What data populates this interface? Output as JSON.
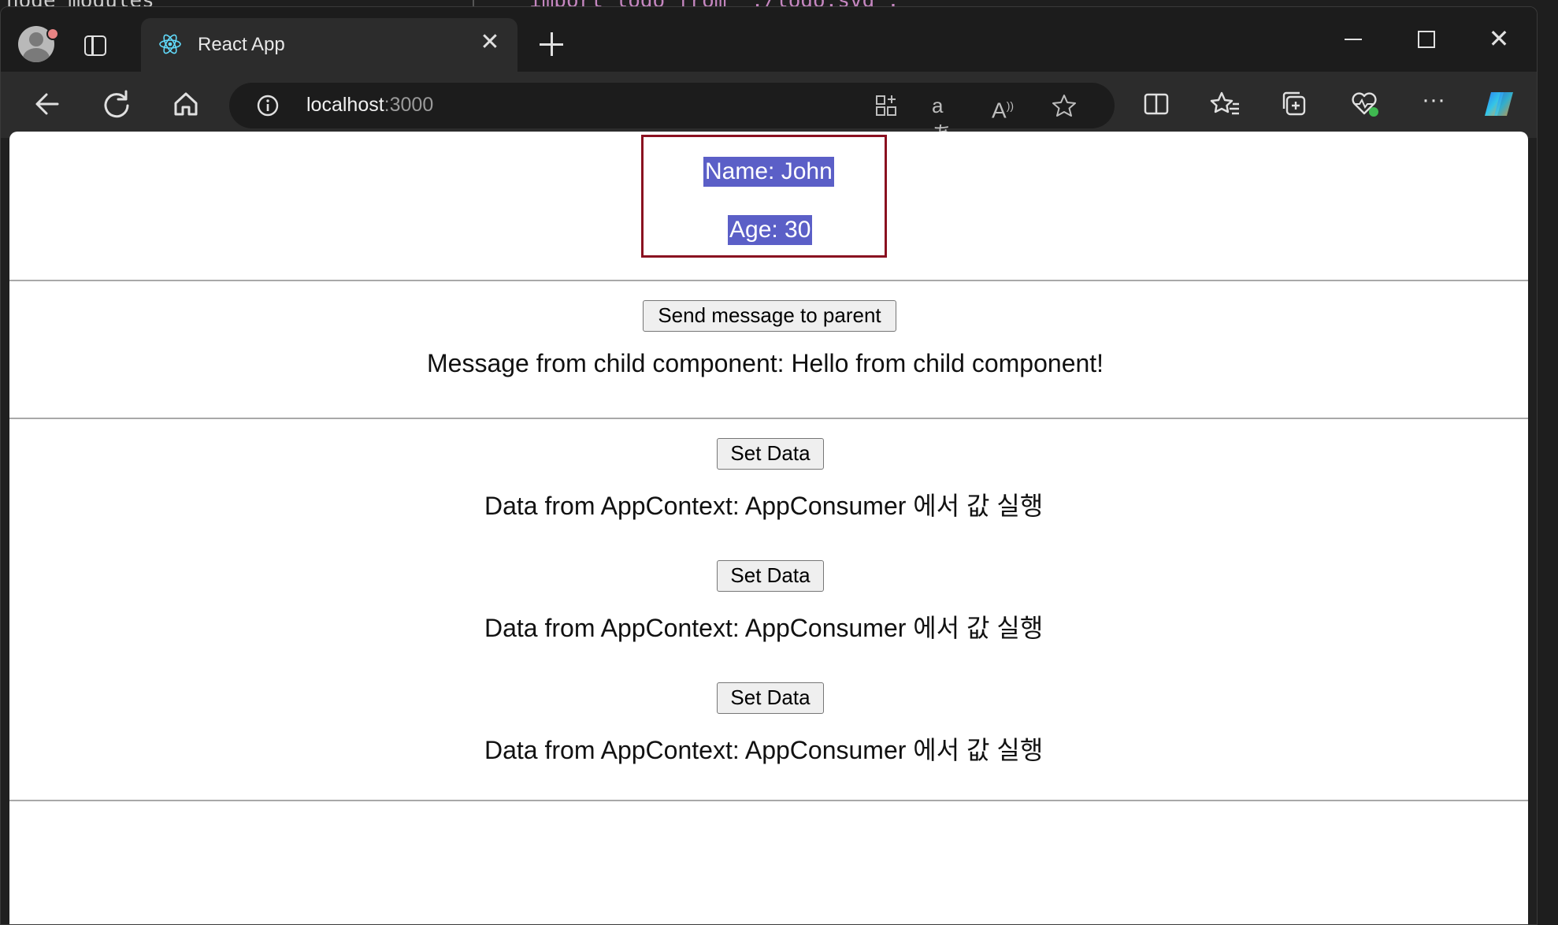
{
  "background_editor": {
    "fragment_left": "node_modules",
    "fragment_right": "import logo from './logo.svg';"
  },
  "browser": {
    "tab": {
      "title": "React App"
    },
    "address_bar": {
      "host": "localhost",
      "port": ":3000"
    }
  },
  "page": {
    "profile": {
      "name_text": "Name: John",
      "age_text": "Age: 30"
    },
    "child_message": {
      "button_label": "Send message to parent",
      "message_text": "Message from child component: Hello from child component!"
    },
    "context_blocks": [
      {
        "button_label": "Set Data",
        "data_text": "Data from AppContext: AppConsumer 에서 값 실행"
      },
      {
        "button_label": "Set Data",
        "data_text": "Data from AppContext: AppConsumer 에서 값 실행"
      },
      {
        "button_label": "Set Data",
        "data_text": "Data from AppContext: AppConsumer 에서 값 실행"
      }
    ]
  },
  "colors": {
    "selection_highlight": "#5b5fc7",
    "box_border": "#8a1020",
    "browser_chrome": "#2c2c2c"
  }
}
